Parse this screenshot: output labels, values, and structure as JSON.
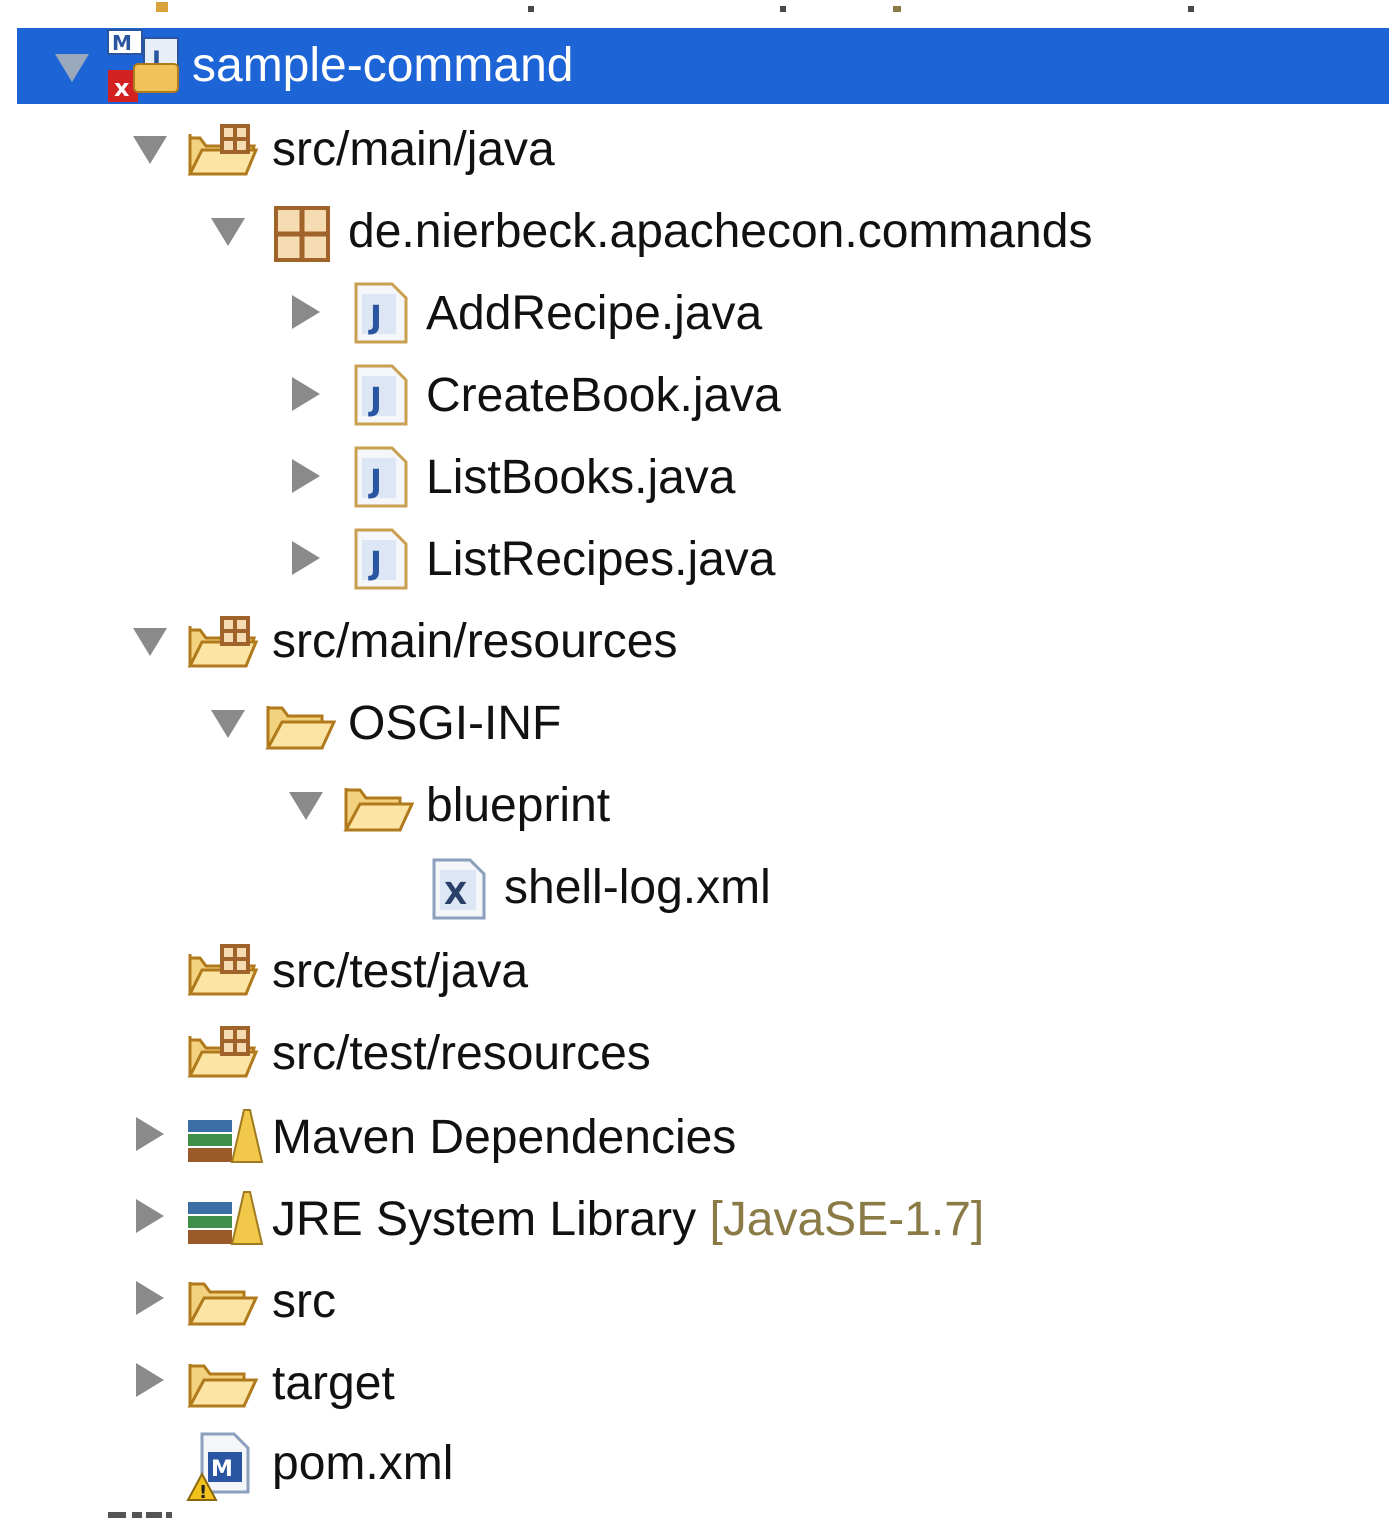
{
  "tree": {
    "project": {
      "label": "sample-command",
      "expanded": true,
      "selected": true
    },
    "items": [
      {
        "label": "src/main/java",
        "icon": "source-folder-icon",
        "expanded": true
      },
      {
        "label": "de.nierbeck.apachecon.commands",
        "icon": "package-icon",
        "expanded": true
      },
      {
        "label": "AddRecipe.java",
        "icon": "java-file-icon",
        "expanded": false
      },
      {
        "label": "CreateBook.java",
        "icon": "java-file-icon",
        "expanded": false
      },
      {
        "label": "ListBooks.java",
        "icon": "java-file-icon",
        "expanded": false
      },
      {
        "label": "ListRecipes.java",
        "icon": "java-file-icon",
        "expanded": false
      },
      {
        "label": "src/main/resources",
        "icon": "source-folder-icon",
        "expanded": true
      },
      {
        "label": "OSGI-INF",
        "icon": "folder-icon",
        "expanded": true
      },
      {
        "label": "blueprint",
        "icon": "folder-icon",
        "expanded": true
      },
      {
        "label": "shell-log.xml",
        "icon": "xml-file-icon"
      },
      {
        "label": "src/test/java",
        "icon": "source-folder-icon"
      },
      {
        "label": "src/test/resources",
        "icon": "source-folder-icon"
      },
      {
        "label": "Maven Dependencies",
        "icon": "library-icon",
        "expanded": false
      },
      {
        "label": "JRE System Library",
        "decoration": "[JavaSE-1.7]",
        "icon": "library-icon",
        "expanded": false
      },
      {
        "label": "src",
        "icon": "folder-icon",
        "expanded": false
      },
      {
        "label": "target",
        "icon": "folder-icon",
        "expanded": false
      },
      {
        "label": "pom.xml",
        "icon": "maven-pom-warning-icon"
      }
    ]
  },
  "colors": {
    "selection": "#1d65d6",
    "decoration": "#8a7a45"
  }
}
